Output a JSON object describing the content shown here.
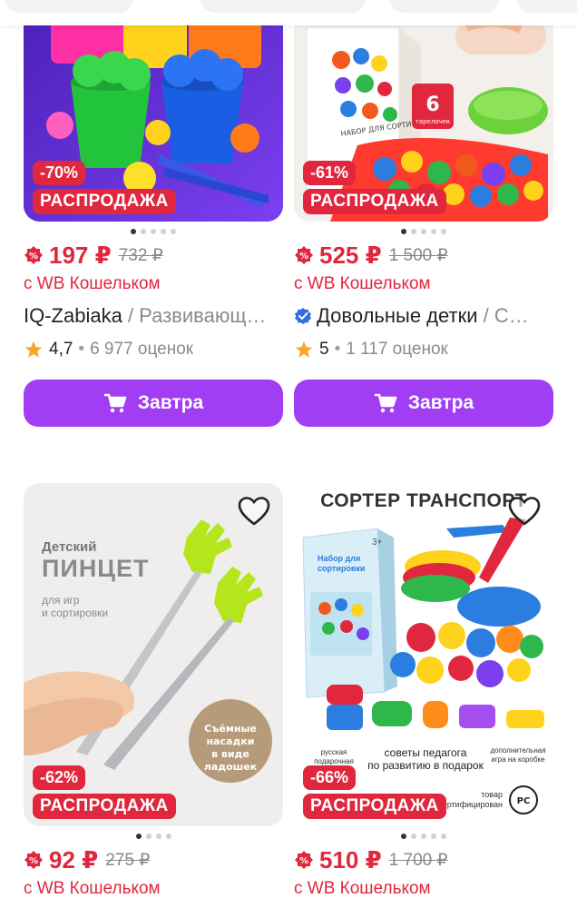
{
  "products": [
    {
      "discount": "-70%",
      "sale_label": "РАСПРОДАЖА",
      "price": "197 ₽",
      "old_price": "732 ₽",
      "wallet_note": "с WB Кошельком",
      "brand": "IQ-Zabiaka",
      "category": " / Развивающ…",
      "verified": false,
      "rating": "4,7",
      "reviews": "6 977 оценок",
      "button_label": "Завтра",
      "dots_active": 0,
      "dots_total": 5
    },
    {
      "discount": "-61%",
      "sale_label": "РАСПРОДАЖА",
      "price": "525 ₽",
      "old_price": "1 500 ₽",
      "wallet_note": "с WB Кошельком",
      "brand": "Довольные детки",
      "category": " / С…",
      "verified": true,
      "rating": "5",
      "reviews": "1 117 оценок",
      "button_label": "Завтра",
      "dots_active": 0,
      "dots_total": 5,
      "image_text": {
        "box": "НАБОР ДЛЯ СОРТИРОВКИ «ЖИВОТ…",
        "count": "6",
        "count_label": "тарелочек"
      }
    },
    {
      "discount": "-62%",
      "sale_label": "РАСПРОДАЖА",
      "price": "92 ₽",
      "old_price": "275 ₽",
      "wallet_note": "с WB Кошельком",
      "dots_active": 0,
      "dots_total": 4,
      "image_text": {
        "line1": "Детский",
        "line2": "ПИНЦЕТ",
        "line3": "для игр",
        "line4": "и сортировки",
        "bubble": "Съёмные насадки в виде ладошек"
      }
    },
    {
      "discount": "-66%",
      "sale_label": "РАСПРОДАЖА",
      "price": "510 ₽",
      "old_price": "1 700 ₽",
      "wallet_note": "с WB Кошельком",
      "dots_active": 0,
      "dots_total": 5,
      "image_text": {
        "title": "СОРТЕР ТРАНСПОРТ",
        "box": "Набор для сортировки",
        "age": "3+",
        "left": "русская подарочная",
        "center1": "советы педагога",
        "center2": "по развитию в подарок",
        "right": "дополнительная игра на коробке",
        "cert": "товар сертифицирован"
      }
    }
  ],
  "colors": {
    "accent": "#a13ef4",
    "sale": "#e0273e",
    "muted": "#8a8a8a"
  },
  "icons": {
    "cart": "cart-icon",
    "heart": "heart-icon",
    "star": "star-icon",
    "wb_badge": "wb-wallet-icon",
    "verified": "verified-icon"
  }
}
